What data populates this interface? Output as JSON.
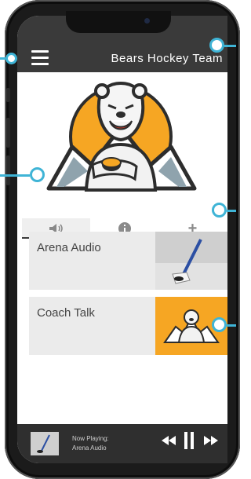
{
  "header": {
    "title": "Bears Hockey Team",
    "menu_icon": "hamburger-menu-icon",
    "bg_color": "#3a3a3a"
  },
  "hero": {
    "logo": "polar-bear-hockey-logo",
    "accent_color": "#f6a623",
    "carousel_pages": 2,
    "carousel_active": 1
  },
  "tabs": [
    {
      "icon": "speaker-icon",
      "glyph": "◀))",
      "active": true
    },
    {
      "icon": "info-icon",
      "glyph": "i",
      "active": false
    },
    {
      "icon": "plus-icon",
      "glyph": "+",
      "active": false
    }
  ],
  "cards": [
    {
      "label": "Arena Audio",
      "thumb": "hockey-stick-puck-photo"
    },
    {
      "label": "Coach Talk",
      "thumb": "bear-logo-orange-tile"
    }
  ],
  "player": {
    "now_playing_label": "Now Playing:",
    "track": "Arena Audio",
    "controls": [
      "rewind-icon",
      "pause-icon",
      "fast-forward-icon"
    ]
  },
  "callout_color": "#3fb4d6"
}
